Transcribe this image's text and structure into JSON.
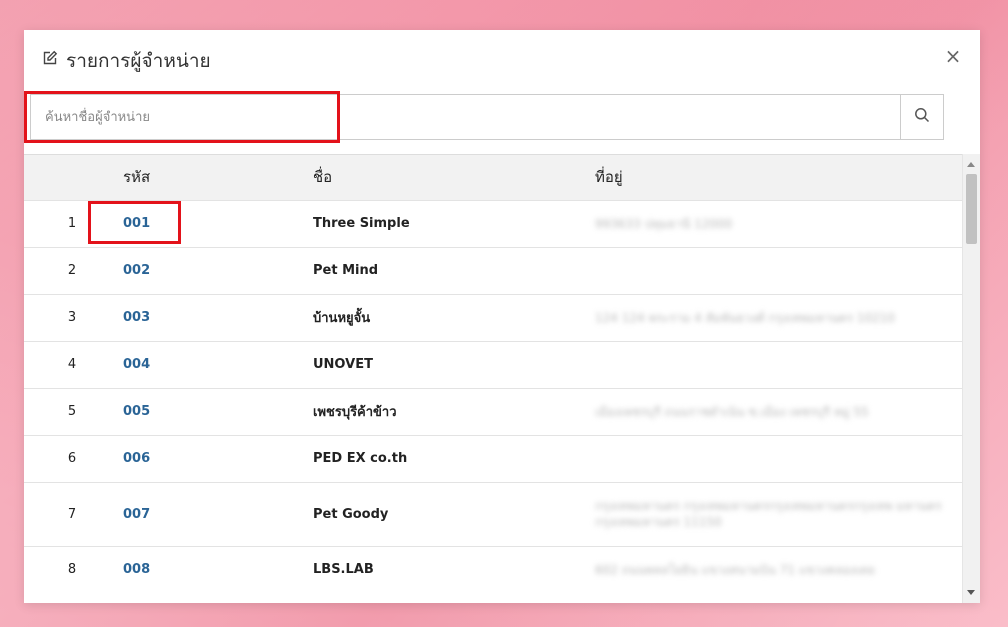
{
  "modal": {
    "title": "รายการผู้จำหน่าย",
    "title_icon": "edit-icon",
    "close_label": "×"
  },
  "search": {
    "placeholder": "ค้นหาชื่อผู้จำหน่าย",
    "value": "",
    "button_icon": "search-icon"
  },
  "table": {
    "headers": {
      "num": "",
      "code": "รหัส",
      "name": "ชื่อ",
      "address": "ที่อยู่"
    },
    "rows": [
      {
        "num": "1",
        "code": "001",
        "name": "Three Simple",
        "address": "993633 ปทุมธานี 12000",
        "height": 47
      },
      {
        "num": "2",
        "code": "002",
        "name": "Pet Mind",
        "address": "",
        "height": 47
      },
      {
        "num": "3",
        "code": "003",
        "name": "บ้านหยูจั้น",
        "address": "124 124 พระราม 4 สัมพันธวงศ์ กรุงเทพมหานคร 10210",
        "height": 47
      },
      {
        "num": "4",
        "code": "004",
        "name": "UNOVET",
        "address": "",
        "height": 47
      },
      {
        "num": "5",
        "code": "005",
        "name": "เพชรบุรีค้าข้าว",
        "address": "เมืองเพชรบุรี ถนนราชดำเนิน ซ.เมือง เพชรบุรี หมู่ 55",
        "height": 47
      },
      {
        "num": "6",
        "code": "006",
        "name": "PED EX co.th",
        "address": "",
        "height": 47
      },
      {
        "num": "7",
        "code": "007",
        "name": "Pet Goody",
        "address": "กรุงเทพมหานคร กรุงเทพมหานครกรุงเทพมหานครกรุงเทพ มหานคร กรุงเทพมหานคร 11150",
        "height": 64
      },
      {
        "num": "8",
        "code": "008",
        "name": "LBS.LAB",
        "address": "602 ถนนพหลโยธิน แขวงสนามบิน 71 แขวงคลองเตย",
        "height": 47
      }
    ]
  },
  "colors": {
    "link": "#2a6496",
    "highlight": "#e3121a",
    "header_bg": "#f2f2f2"
  }
}
